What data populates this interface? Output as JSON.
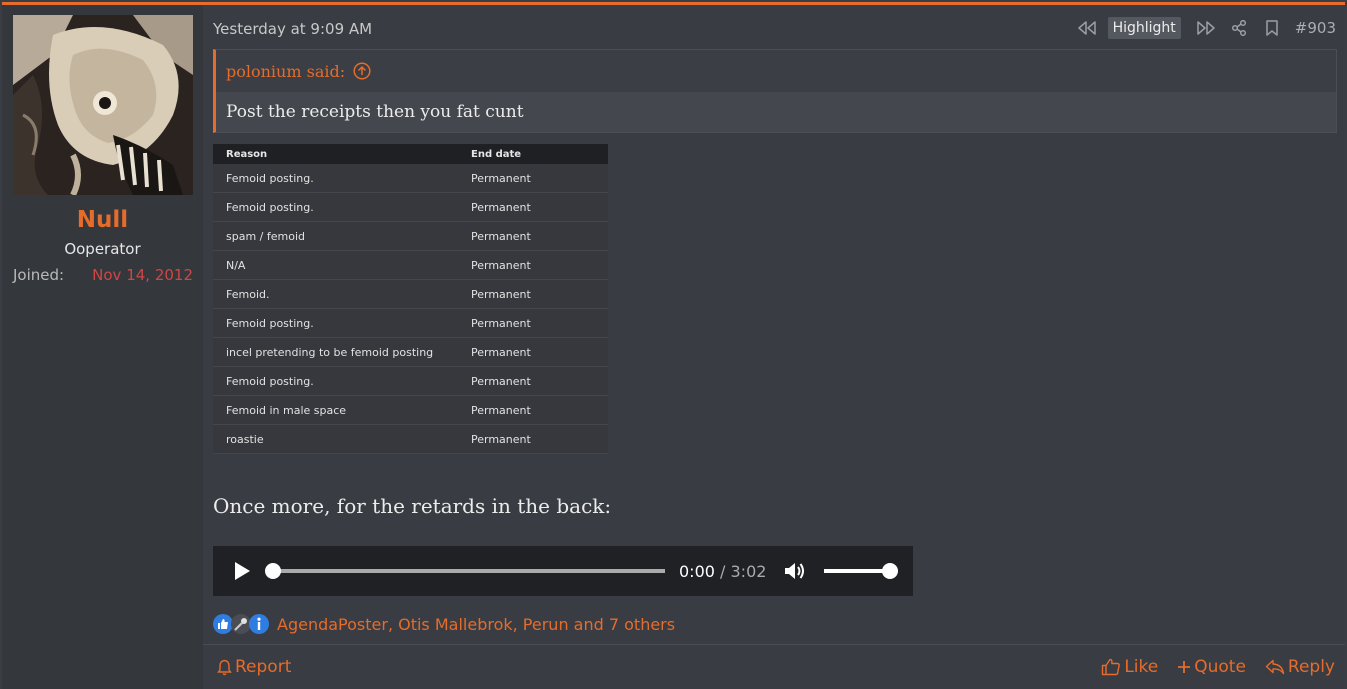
{
  "user": {
    "name": "Null",
    "title": "Ooperator",
    "joined_label": "Joined:",
    "joined_value": "Nov 14, 2012"
  },
  "post": {
    "timestamp": "Yesterday at 9:09 AM",
    "highlight_label": "Highlight",
    "post_number": "#903",
    "quote": {
      "author": "polonium said:",
      "text": "Post the receipts then you fat cunt"
    },
    "ban_table": {
      "headers": [
        "Reason",
        "End date"
      ],
      "rows": [
        [
          "Femoid posting.",
          "Permanent"
        ],
        [
          "Femoid posting.",
          "Permanent"
        ],
        [
          "spam / femoid",
          "Permanent"
        ],
        [
          "N/A",
          "Permanent"
        ],
        [
          "Femoid.",
          "Permanent"
        ],
        [
          "Femoid posting.",
          "Permanent"
        ],
        [
          "incel pretending to be femoid posting",
          "Permanent"
        ],
        [
          "Femoid posting.",
          "Permanent"
        ],
        [
          "Femoid in male space",
          "Permanent"
        ],
        [
          "roastie",
          "Permanent"
        ]
      ]
    },
    "body_text": "Once more, for the retards in the back:",
    "audio": {
      "current_time": "0:00",
      "separator": " / ",
      "duration": "3:02",
      "progress_fraction": 0.0,
      "volume_fraction": 1.0
    },
    "reactions": {
      "icons": [
        "thumbs-up-icon",
        "microphone-icon",
        "info-icon"
      ],
      "names_text": "AgendaPoster, Otis Mallebrok, Perun and 7 others"
    }
  },
  "footer": {
    "report_label": "Report",
    "like_label": "Like",
    "quote_label": "Quote",
    "reply_label": "Reply"
  },
  "colors": {
    "accent": "#e56c2b",
    "joined_date": "#d24545",
    "background": "#393c42"
  }
}
